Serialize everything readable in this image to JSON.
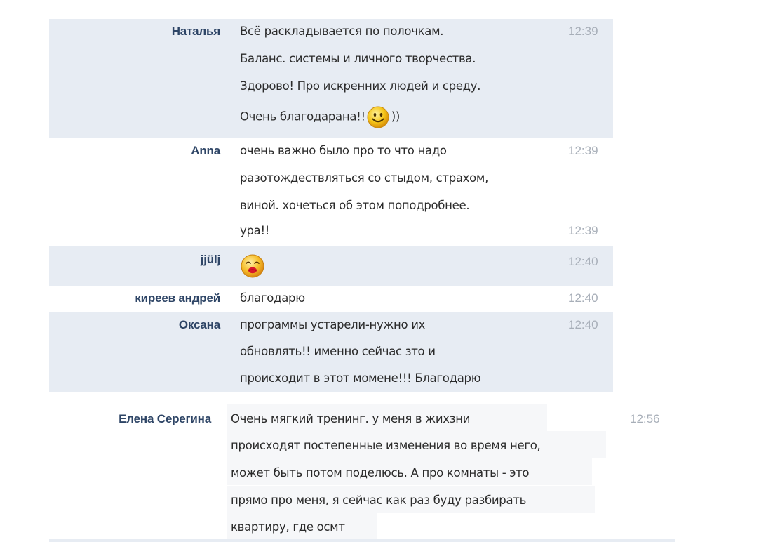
{
  "messages": [
    {
      "author": "Наталья",
      "time": "12:39",
      "lines": [
        "Всё раскладывается по полочкам.",
        "Баланс. системы и личного творчества.",
        "Здорово! Про искренних людей и среду.",
        "Очень благодарана!!"
      ],
      "after_smiley": "))"
    },
    {
      "author": "Anna",
      "time": "12:39",
      "lines": [
        "очень важно было про то что надо",
        "разотождествляться со стыдом, страхом,",
        "виной. хочеться об этом поподробнее.",
        "ура!!"
      ],
      "time2": "12:39"
    },
    {
      "author": "jjülj",
      "time": "12:40"
    },
    {
      "author": "киреев андрей",
      "time": "12:40",
      "lines": [
        "благодарю"
      ]
    },
    {
      "author": "Оксана",
      "time": "12:40",
      "lines": [
        "программы устарели-нужно их",
        "обновлять!! именно сейчас зто и",
        "происходит в этот момене!!! Благодарю"
      ]
    },
    {
      "author": "Елена Серегина",
      "time": "12:56",
      "lines": [
        "Очень мягкий тренинг.  у меня в жихзни",
        "происходят постепенные изменения во время него,",
        "может быть потом поделюсь. А про комнаты - это",
        "прямо про меня, я сейчас как раз буду разбирать",
        "квартиру, где осмт"
      ]
    }
  ],
  "icons": {
    "smile": "smile-emoticon-icon",
    "kiss": "kiss-emoticon-icon"
  },
  "colors": {
    "row_shade": "#e7ecf3",
    "author": "#2e4566",
    "time": "#a7aeb8",
    "smiley_yellow": "#f5c518"
  }
}
